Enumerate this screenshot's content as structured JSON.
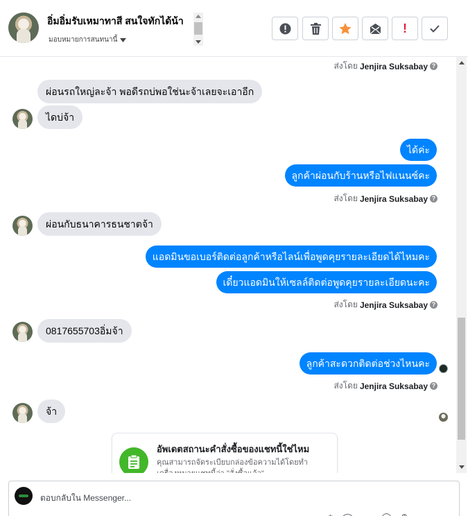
{
  "header": {
    "contact_name": "อิ่มอิ่มรับเหมาทาสี สนใจทักได้น้า",
    "assign_label": "มอบหมายการสนทนานี้",
    "actions": {
      "spam": "!",
      "delete": "trash-icon",
      "star": "star-icon",
      "unread": "envelope-icon",
      "flag": "!",
      "done": "check-icon"
    },
    "colors": {
      "star": "#f7923a",
      "flag": "#e41e3f"
    }
  },
  "messages": [
    {
      "side": "meta",
      "sent_by_prefix": "ส่งโดย",
      "sent_by_name": "Jenjira Suksabay"
    },
    {
      "side": "in",
      "text": "ผ่อนรถใหญ่ละจ้า  พอดีรถบ่พอใช่นะจ้าเลยจะเอาอีก"
    },
    {
      "side": "in",
      "text": "ไดบ่จ้า"
    },
    {
      "side": "out",
      "text": "ได้ค่ะ"
    },
    {
      "side": "out",
      "text": "ลูกค้าผ่อนกับร้านหรือไฟแนนซ์คะ"
    },
    {
      "side": "meta",
      "sent_by_prefix": "ส่งโดย",
      "sent_by_name": "Jenjira Suksabay"
    },
    {
      "side": "in",
      "text": "ผ่อนกับธนาคารธนชาตจ้า"
    },
    {
      "side": "out",
      "text": "แอดมินขอเบอร์ติดต่อลูกค้าหรือไลน์เพื่อพูดคุยรายละเอียดได้ไหมคะ"
    },
    {
      "side": "out",
      "text": "เดี๋ยวแอดมินให้เซลล์ติดต่อพูดคุยรายละเอียดนะคะ"
    },
    {
      "side": "meta",
      "sent_by_prefix": "ส่งโดย",
      "sent_by_name": "Jenjira Suksabay"
    },
    {
      "side": "in",
      "text": "0817655703อิ่มจ้า"
    },
    {
      "side": "out",
      "text": "ลูกค้าสะดวกติดต่อช่วงไหนคะ"
    },
    {
      "side": "meta",
      "sent_by_prefix": "ส่งโดย",
      "sent_by_name": "Jenjira Suksabay"
    },
    {
      "side": "in",
      "text": "จ้า"
    }
  ],
  "card": {
    "title": "อัพเดตสถานะคำสั่งซื้อของแชทนี้ใช่ไหม",
    "body": "คุณสามารถจัดระเบียบกล่องข้อความได้โดยทำเครื่องหมายแชทนี้ว่า \"สั่งซื้อแล้ว\""
  },
  "composer": {
    "placeholder": "ตอบกลับใน Messenger..."
  },
  "colors": {
    "outgoing": "#0084ff",
    "incoming": "#e4e6eb",
    "card_icon": "#42b72a"
  }
}
